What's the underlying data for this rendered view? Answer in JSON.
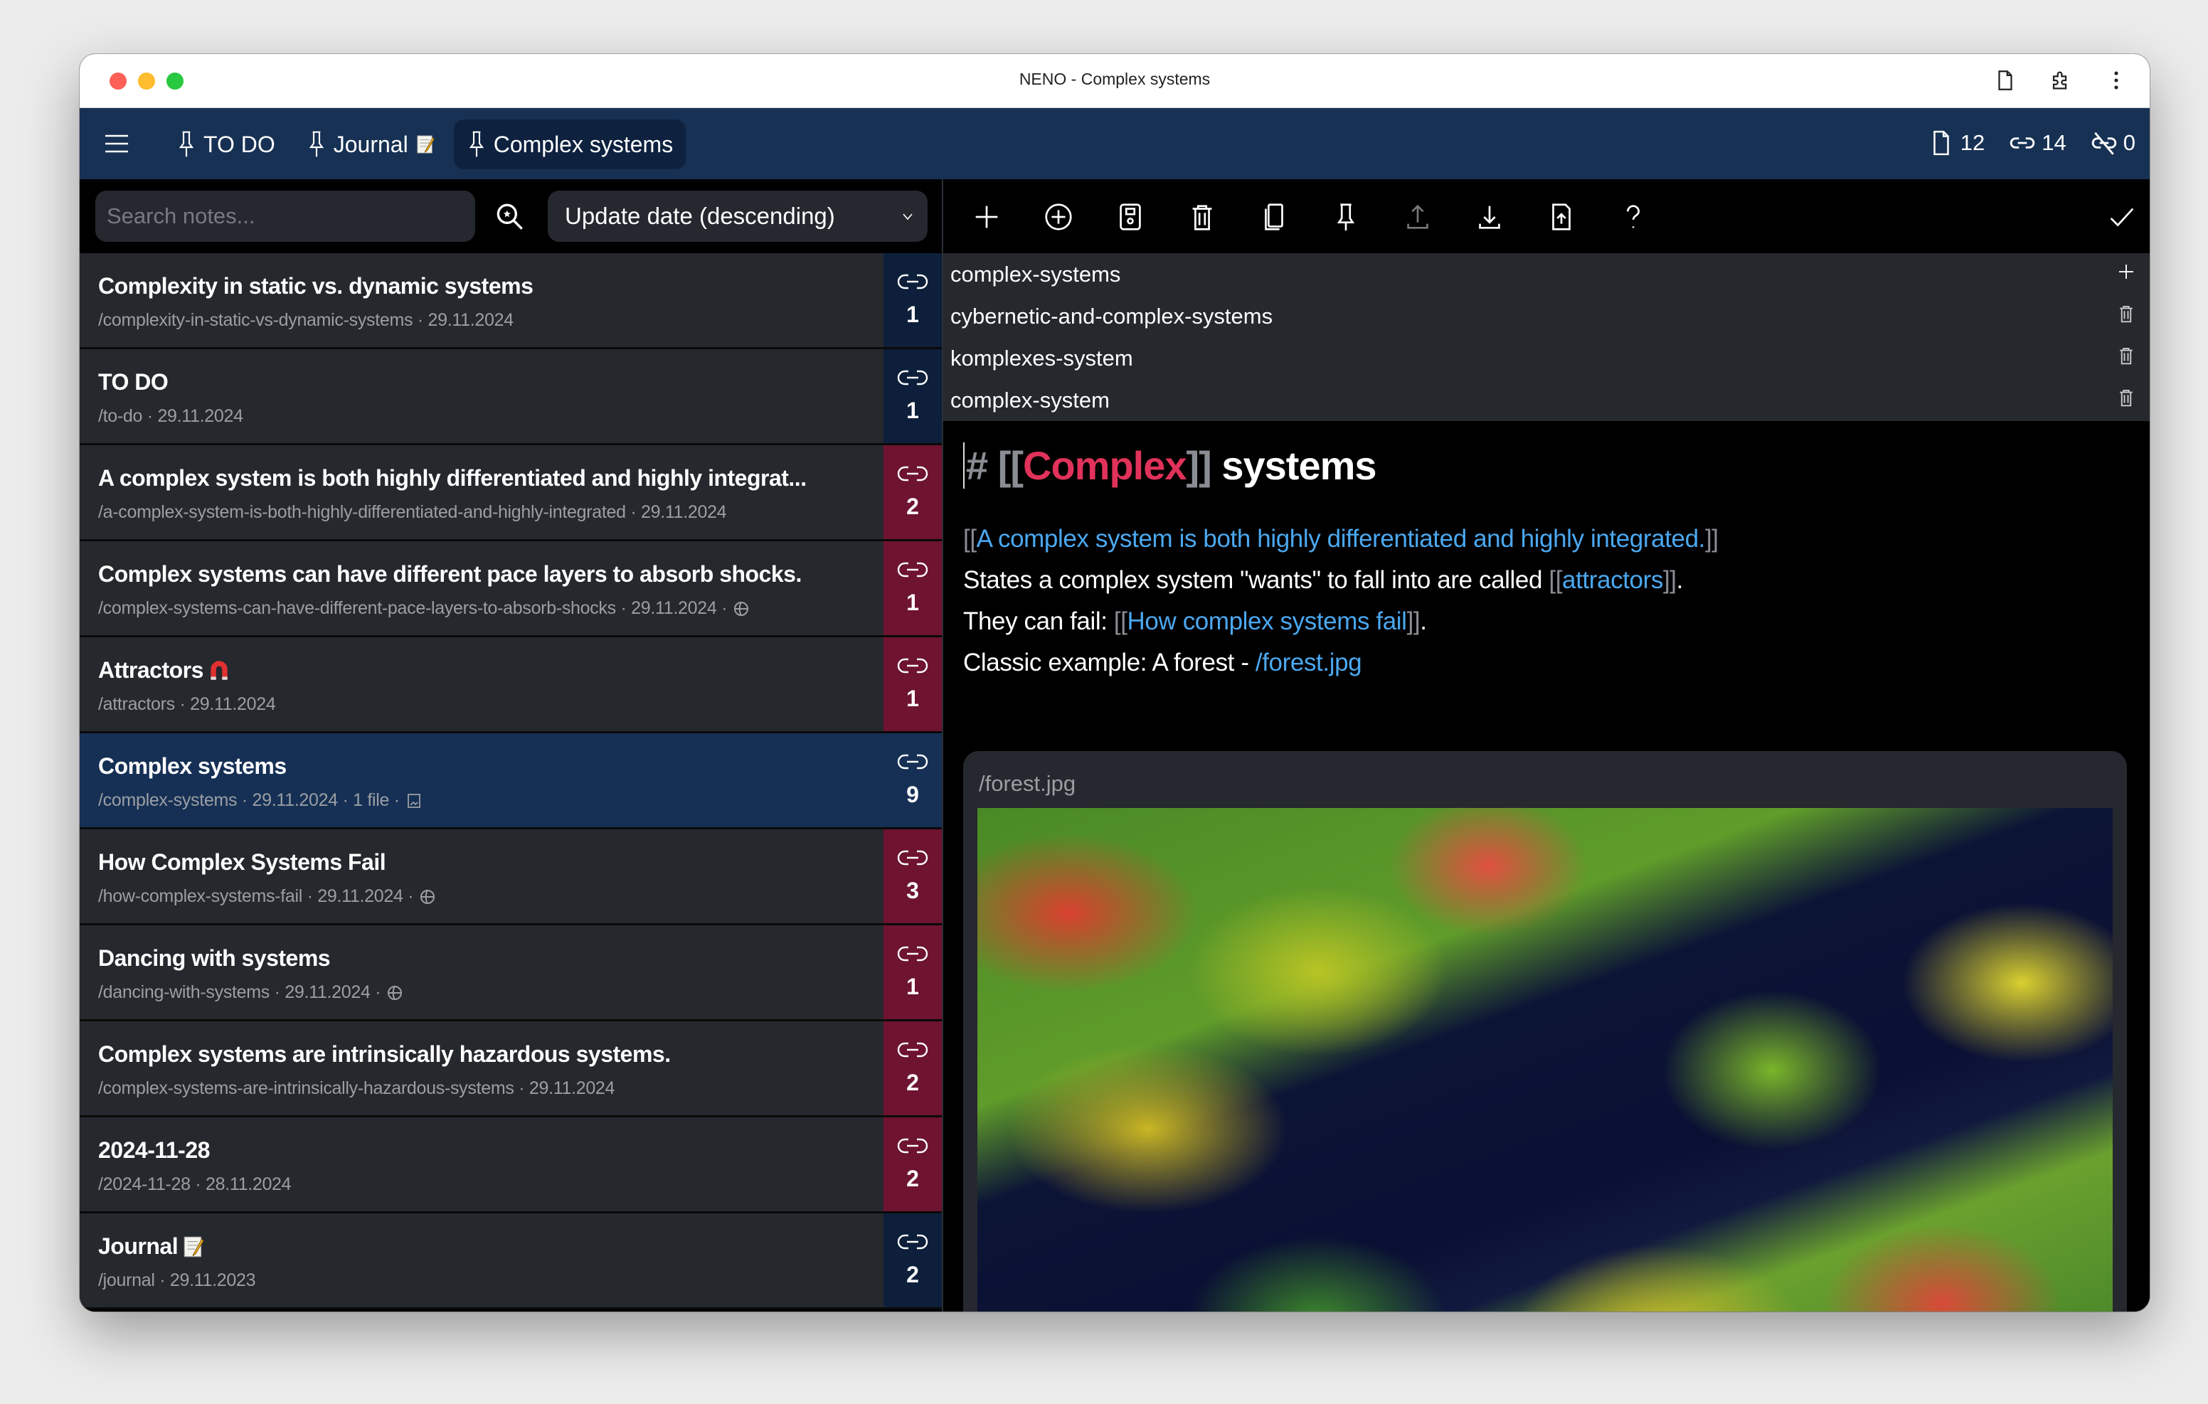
{
  "window": {
    "title": "NENO - Complex systems"
  },
  "colors": {
    "header": "#173154",
    "row": "#25282d",
    "selected": "#163055",
    "badge_navy": "#0d1f3a",
    "badge_red": "#6e1330",
    "link": "#4ba8f0",
    "heading_link": "#e0325a"
  },
  "header": {
    "pinned_tabs": [
      {
        "label": "TO DO",
        "emoji": "none"
      },
      {
        "label": "Journal",
        "emoji": "memo"
      },
      {
        "label": "Complex systems",
        "emoji": "none",
        "active": true
      }
    ],
    "stats": {
      "notes": "12",
      "links": "14",
      "unlinked": "0"
    }
  },
  "search": {
    "placeholder": "Search notes...",
    "value": ""
  },
  "sort": {
    "selected": "Update date (descending)"
  },
  "toolbar": {
    "icons": [
      "plus-icon",
      "plus-circle-icon",
      "save-icon",
      "trash-icon",
      "duplicate-icon",
      "pin-icon",
      "upload-icon",
      "download-icon",
      "file-upload-icon",
      "help-icon"
    ],
    "confirm_icon": "check-icon"
  },
  "notes": [
    {
      "title": "Complexity in static vs. dynamic systems",
      "meta": "/complexity-in-static-vs-dynamic-systems · 29.11.2024",
      "links": "1",
      "badge": "navy"
    },
    {
      "title": "TO DO",
      "meta": "/to-do · 29.11.2024",
      "links": "1",
      "badge": "navy"
    },
    {
      "title": "A complex system is both highly differentiated and highly integrat...",
      "meta": "/a-complex-system-is-both-highly-differentiated-and-highly-integrated · 29.11.2024",
      "links": "2",
      "badge": "red"
    },
    {
      "title": "Complex systems can have different pace layers to absorb shocks.",
      "meta": "/complex-systems-can-have-different-pace-layers-to-absorb-shocks · 29.11.2024 ·",
      "meta_icon": "globe",
      "links": "1",
      "badge": "red"
    },
    {
      "title": "Attractors",
      "emoji": "magnet",
      "meta": "/attractors · 29.11.2024",
      "links": "1",
      "badge": "red"
    },
    {
      "title": "Complex systems",
      "meta": "/complex-systems · 29.11.2024 · 1 file ·",
      "meta_icon": "image",
      "links": "9",
      "badge": "selected",
      "selected": true
    },
    {
      "title": "How Complex Systems Fail",
      "meta": "/how-complex-systems-fail · 29.11.2024 ·",
      "meta_icon": "globe",
      "links": "3",
      "badge": "red"
    },
    {
      "title": "Dancing with systems",
      "meta": "/dancing-with-systems · 29.11.2024 ·",
      "meta_icon": "globe",
      "links": "1",
      "badge": "red"
    },
    {
      "title": "Complex systems are intrinsically hazardous systems.",
      "meta": "/complex-systems-are-intrinsically-hazardous-systems · 29.11.2024",
      "links": "2",
      "badge": "red"
    },
    {
      "title": "2024-11-28",
      "meta": "/2024-11-28 · 28.11.2024",
      "links": "2",
      "badge": "red"
    },
    {
      "title": "Journal",
      "emoji": "memo",
      "meta": "/journal · 29.11.2023",
      "links": "2",
      "badge": "navy"
    }
  ],
  "aliases": [
    {
      "value": "complex-systems",
      "action": "add"
    },
    {
      "value": "cybernetic-and-complex-systems",
      "action": "delete"
    },
    {
      "value": "komplexes-system",
      "action": "delete"
    },
    {
      "value": "complex-system",
      "action": "delete"
    }
  ],
  "editor": {
    "heading": {
      "hash": "#",
      "open": "[[",
      "link": "Complex",
      "close": "]]",
      "rest": "systems"
    },
    "line1": {
      "open": "[[",
      "link": "A complex system is both highly differentiated and highly integrated.",
      "close": "]]"
    },
    "line2": {
      "pre": "States a complex system \"wants\" to fall into are called ",
      "open": "[[",
      "link": "attractors",
      "close": "]]",
      "post": "."
    },
    "line3": {
      "pre": "They can fail: ",
      "open": "[[",
      "link": "How complex systems fail",
      "close": "]]",
      "post": "."
    },
    "line4": {
      "pre": "Classic example: A forest - ",
      "link": "/forest.jpg"
    },
    "file_card": {
      "label": "/forest.jpg",
      "content": "aerial photo of autumn forest around a dark river"
    }
  }
}
